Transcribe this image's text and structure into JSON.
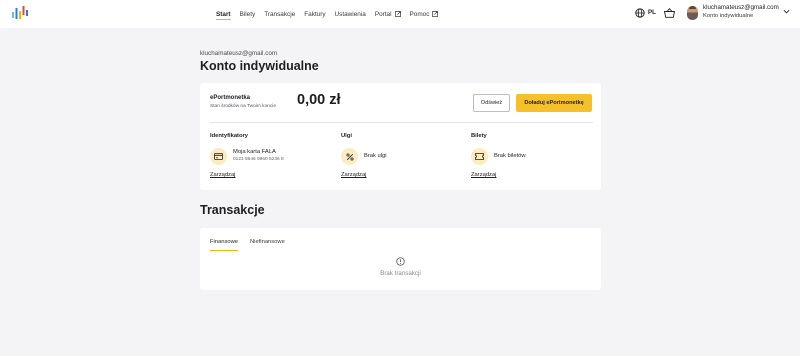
{
  "header": {
    "nav": [
      {
        "label": "Start",
        "active": true,
        "external": false
      },
      {
        "label": "Bilety",
        "active": false,
        "external": false
      },
      {
        "label": "Transakcje",
        "active": false,
        "external": false
      },
      {
        "label": "Faktury",
        "active": false,
        "external": false
      },
      {
        "label": "Ustawienia",
        "active": false,
        "external": false
      },
      {
        "label": "Portal",
        "active": false,
        "external": true
      },
      {
        "label": "Pomoc",
        "active": false,
        "external": true
      }
    ],
    "language": "PL",
    "user_email": "kluchamateusz@gmail.com",
    "user_account": "Konto indywidualne",
    "icons": [
      "logo-icon",
      "globe-icon",
      "basket-icon",
      "avatar",
      "chevron-down-icon",
      "external-link-icon"
    ]
  },
  "page": {
    "email": "kluchamateusz@gmail.com",
    "title": "Konto indywidualne"
  },
  "wallet": {
    "label": "ePortmonetka",
    "subtitle": "Stan środków na Twoim koncie",
    "amount": "0,00 zł",
    "refresh_label": "Odśwież",
    "topup_label": "Doładuj ePortmonetkę"
  },
  "columns": {
    "identifiers": {
      "heading": "Identyfikatory",
      "item": "Moja karta FALA",
      "item_sub": "0121 8646 9960 5236 8",
      "link": "Zarządzaj",
      "icon": "card-icon"
    },
    "discounts": {
      "heading": "Ulgi",
      "item": "Brak ulgi",
      "link": "Zarządzaj",
      "icon": "percent-icon"
    },
    "tickets": {
      "heading": "Bilety",
      "item": "Brak biletów",
      "link": "Zarządzaj",
      "icon": "ticket-icon"
    }
  },
  "transactions": {
    "title": "Transakcje",
    "tabs": [
      {
        "label": "Finansowe",
        "active": true
      },
      {
        "label": "Niefinansowe",
        "active": false
      }
    ],
    "empty_text": "Brak transakcji",
    "empty_icon": "info-icon"
  },
  "colors": {
    "accent": "#f2b705",
    "button_primary": "#f6c02b",
    "icon_circle": "#fbecc1",
    "background": "#f4f4f6"
  }
}
